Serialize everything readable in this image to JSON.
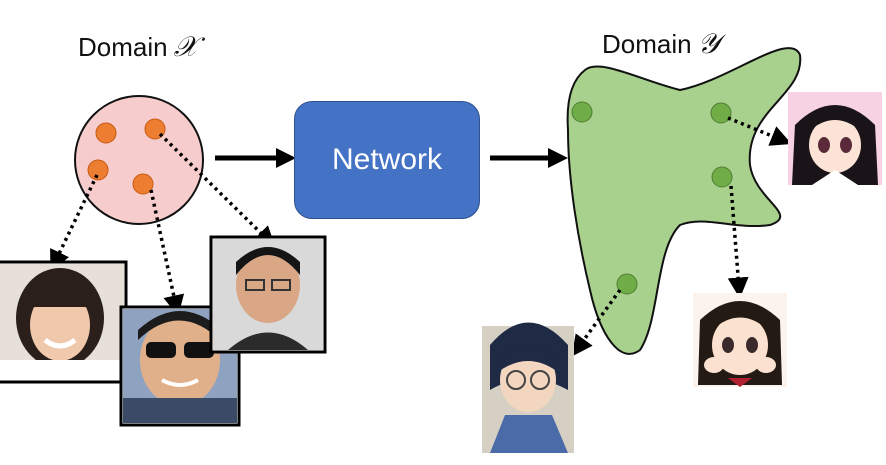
{
  "domain_x": {
    "word": "Domain",
    "symbol": "𝒳"
  },
  "domain_y": {
    "word": "Domain",
    "symbol": "𝒴"
  },
  "network_label": "Network",
  "colors": {
    "source_blob_fill": "#f6cccc",
    "source_dot": "#ed7d31",
    "target_blob_fill": "#a9d18e",
    "target_dot": "#70ad47",
    "network_fill": "#4472c4"
  },
  "images": {
    "source_photos": [
      "real-face-woman",
      "real-face-man-sunglasses",
      "real-face-man-glasses"
    ],
    "target_images": [
      "anime-boy-glasses",
      "anime-girl-hands",
      "anime-girl-twintails"
    ]
  }
}
